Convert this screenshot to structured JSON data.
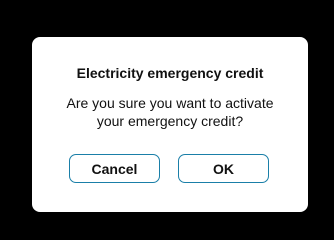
{
  "dialog": {
    "title": "Electricity emergency credit",
    "message_line1": "Are you sure you want to activate",
    "message_line2": "your emergency credit?",
    "cancel_label": "Cancel",
    "ok_label": "OK"
  },
  "colors": {
    "background": "#000000",
    "dialog_background": "#ffffff",
    "button_border": "#1a7fa8",
    "text": "#111111"
  }
}
